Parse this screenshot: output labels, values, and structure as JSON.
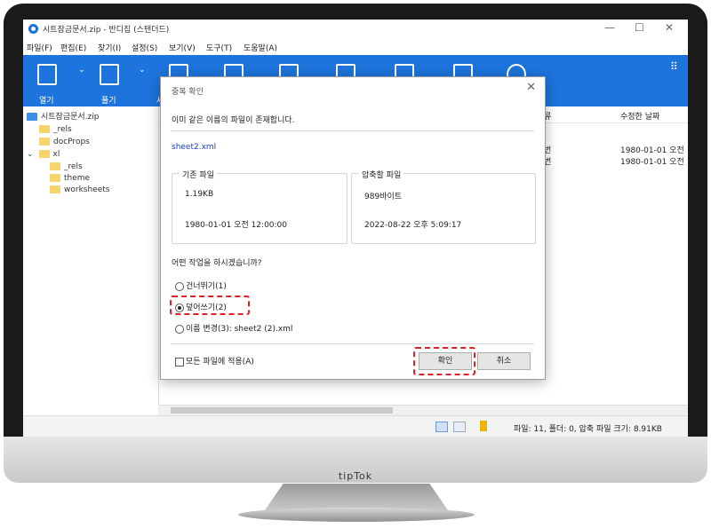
{
  "window": {
    "title": "시트잠금문서.zip - 반디집 (스탠더드)",
    "minimize_label": "—",
    "maximize_label": "☐",
    "close_label": "✕"
  },
  "menu": {
    "items": [
      {
        "label": "파일(F)"
      },
      {
        "label": "편집(E)"
      },
      {
        "label": "찾기(I)"
      },
      {
        "label": "설정(S)"
      },
      {
        "label": "보기(V)"
      },
      {
        "label": "도구(T)"
      },
      {
        "label": "도움말(A)"
      }
    ]
  },
  "toolbar": {
    "open_label": "열기",
    "extract_label": "풀기",
    "extra_label": "새",
    "chevron": "⌄",
    "grid_glyph": "⠿"
  },
  "tree": {
    "root": "시트잠금문서.zip",
    "items": [
      {
        "label": "_rels"
      },
      {
        "label": "docProps"
      },
      {
        "label": "xl"
      },
      {
        "label": "_rels"
      },
      {
        "label": "theme"
      },
      {
        "label": "worksheets"
      }
    ],
    "expand_glyph": "⌄"
  },
  "list": {
    "type_header_partial": "류",
    "modified_header": "수정한 날짜",
    "rows": [
      {
        "type_partial": "번",
        "modified": "1980-01-01 오전"
      },
      {
        "type_partial": "번",
        "modified": "1980-01-01 오전"
      }
    ]
  },
  "statusbar": {
    "text": "파일: 11, 폴더: 0, 압축 파일 크기: 8.91KB"
  },
  "dialog": {
    "title": "중복 확인",
    "close_label": "✕",
    "message": "이미 같은 이름의 파일이 존재합니다.",
    "filename": "sheet2.xml",
    "existing": {
      "title": "기존 파일",
      "size": "1.19KB",
      "date": "1980-01-01 오전 12:00:00"
    },
    "incoming": {
      "title": "압축할 파일",
      "size": "989바이트",
      "date": "2022-08-22 오후 5:09:17"
    },
    "question": "어떤 작업을 하시겠습니까?",
    "options": [
      {
        "label": "건너뛰기(1)",
        "selected": false
      },
      {
        "label": "덮어쓰기(2)",
        "selected": true
      },
      {
        "label": "이름 변경(3): sheet2 (2).xml",
        "selected": false
      }
    ],
    "apply_all_label": "모든 파일에 적용(A)",
    "confirm_label": "확인",
    "cancel_label": "취소"
  },
  "monitor": {
    "brand": "tipTok"
  },
  "colors": {
    "accent": "#1d74dc",
    "highlight": "#e02020",
    "link": "#1c3fc4"
  }
}
